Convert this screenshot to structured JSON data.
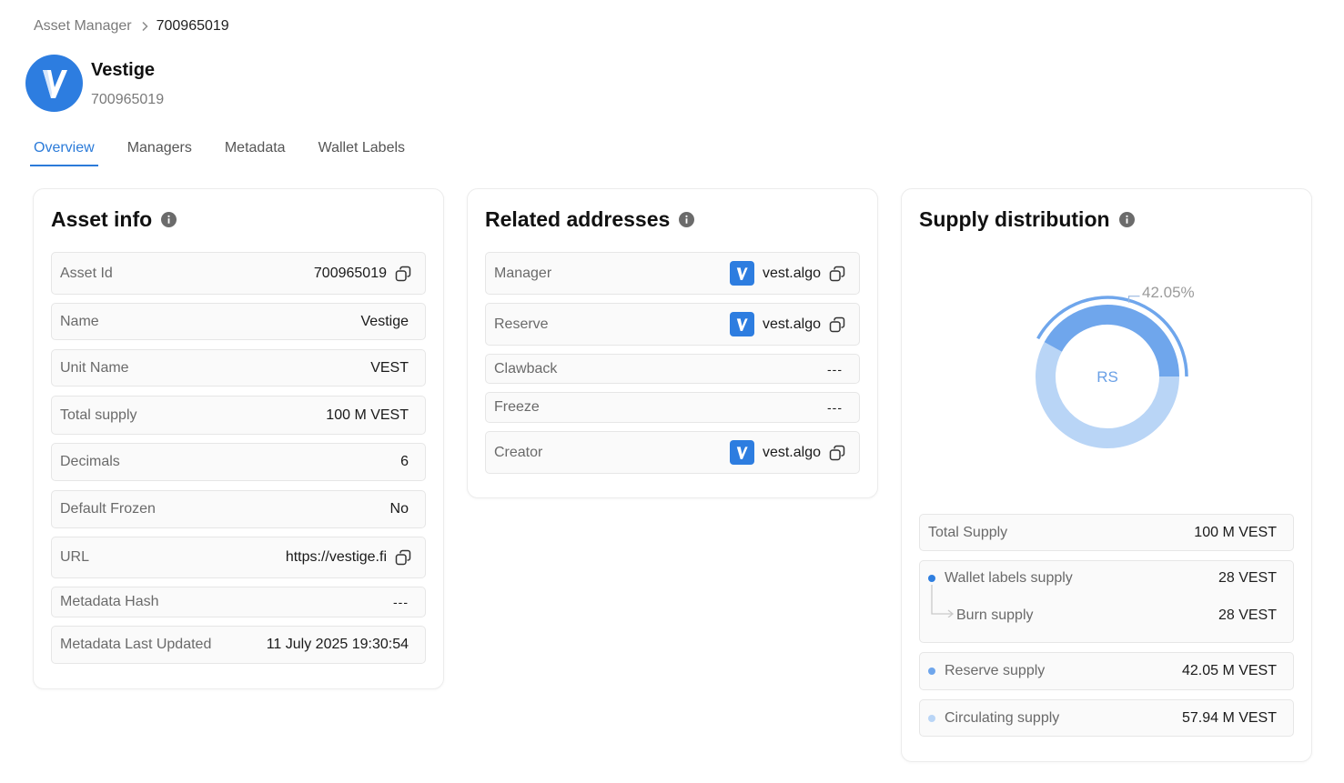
{
  "breadcrumb": {
    "parent": "Asset Manager",
    "current": "700965019"
  },
  "asset": {
    "name": "Vestige",
    "id": "700965019",
    "logo_icon": "vestige-logo-icon"
  },
  "tabs": [
    {
      "label": "Overview",
      "active": true
    },
    {
      "label": "Managers",
      "active": false
    },
    {
      "label": "Metadata",
      "active": false
    },
    {
      "label": "Wallet Labels",
      "active": false
    }
  ],
  "asset_info": {
    "title": "Asset info",
    "rows": [
      {
        "label": "Asset Id",
        "value": "700965019"
      },
      {
        "label": "Name",
        "value": "Vestige"
      },
      {
        "label": "Unit Name",
        "value": "VEST"
      },
      {
        "label": "Total supply",
        "value": "100 M VEST"
      },
      {
        "label": "Decimals",
        "value": "6"
      },
      {
        "label": "Default Frozen",
        "value": "No"
      },
      {
        "label": "URL",
        "value": "https://vestige.fi"
      },
      {
        "label": "Metadata Hash",
        "value": "---"
      },
      {
        "label": "Metadata Last Updated",
        "value": "11 July 2025 19:30:54"
      }
    ]
  },
  "related_addresses": {
    "title": "Related addresses",
    "rows": [
      {
        "label": "Manager",
        "value": "vest.algo"
      },
      {
        "label": "Reserve",
        "value": "vest.algo"
      },
      {
        "label": "Clawback",
        "value": "---"
      },
      {
        "label": "Freeze",
        "value": "---"
      },
      {
        "label": "Creator",
        "value": "vest.algo"
      }
    ]
  },
  "supply_distribution": {
    "title": "Supply distribution",
    "chart": {
      "center_label": "RS",
      "reserve_percent_label": "42.05%",
      "reserve_fraction": 0.4205
    },
    "total": {
      "label": "Total Supply",
      "value": "100 M VEST"
    },
    "wallet_labels": {
      "label": "Wallet labels supply",
      "value": "28 VEST"
    },
    "burn": {
      "label": "Burn supply",
      "value": "28 VEST"
    },
    "reserve": {
      "label": "Reserve supply",
      "value": "42.05 M VEST"
    },
    "circulating": {
      "label": "Circulating supply",
      "value": "57.94 M VEST"
    }
  },
  "colors": {
    "accent": "#2b7bd9",
    "reserve": "#6fa6ec",
    "circulating": "#b9d5f6",
    "wallet_dot": "#2f7fe0"
  }
}
